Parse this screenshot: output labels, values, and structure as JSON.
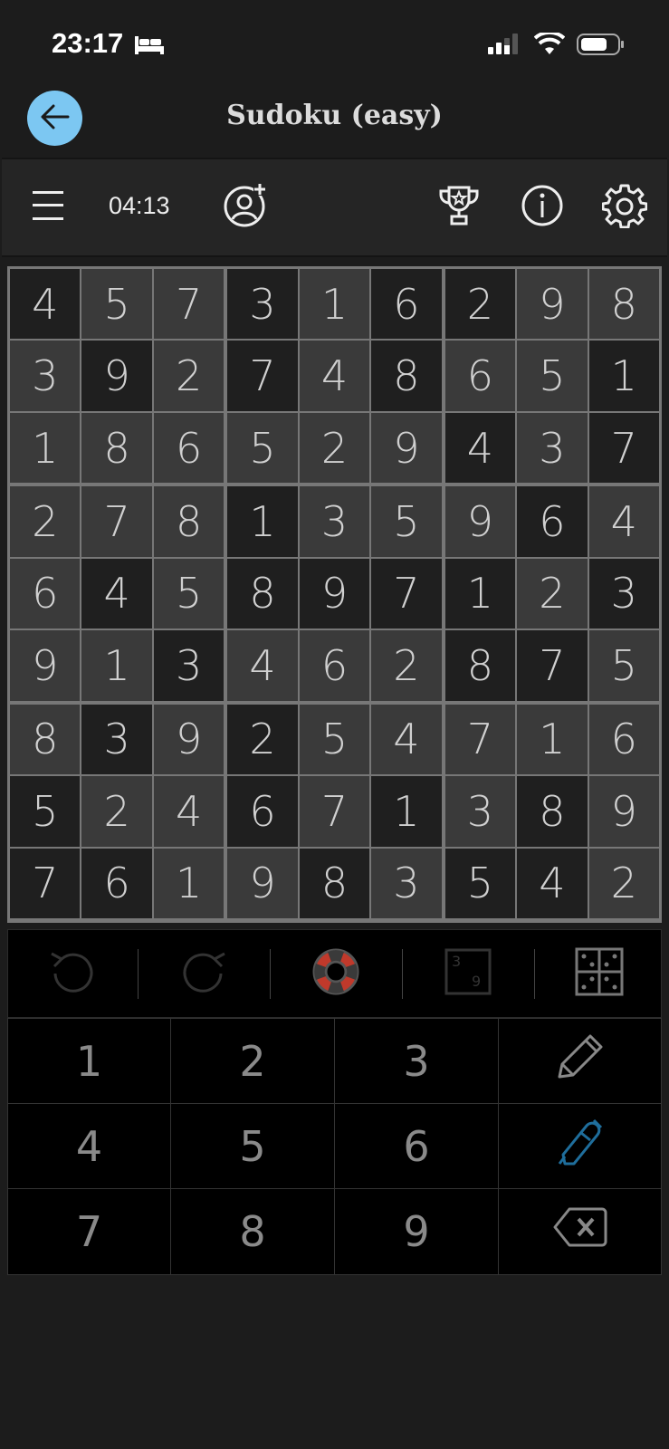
{
  "status_bar": {
    "time": "23:17",
    "icons": [
      "bed-icon",
      "cellular-signal-icon",
      "wifi-icon",
      "battery-icon"
    ]
  },
  "header": {
    "title": "Sudoku (easy)",
    "back_icon": "arrow-left-icon",
    "back_color": "#7cc7f2"
  },
  "toolbar": {
    "timer": "04:13",
    "icons": [
      "menu-icon",
      "add-user-icon",
      "trophy-icon",
      "info-icon",
      "settings-icon"
    ]
  },
  "grid": {
    "rows": [
      [
        "4",
        "5",
        "7",
        "3",
        "1",
        "6",
        "2",
        "9",
        "8"
      ],
      [
        "3",
        "9",
        "2",
        "7",
        "4",
        "8",
        "6",
        "5",
        "1"
      ],
      [
        "1",
        "8",
        "6",
        "5",
        "2",
        "9",
        "4",
        "3",
        "7"
      ],
      [
        "2",
        "7",
        "8",
        "1",
        "3",
        "5",
        "9",
        "6",
        "4"
      ],
      [
        "6",
        "4",
        "5",
        "8",
        "9",
        "7",
        "1",
        "2",
        "3"
      ],
      [
        "9",
        "1",
        "3",
        "4",
        "6",
        "2",
        "8",
        "7",
        "5"
      ],
      [
        "8",
        "3",
        "9",
        "2",
        "5",
        "4",
        "7",
        "1",
        "6"
      ],
      [
        "5",
        "2",
        "4",
        "6",
        "7",
        "1",
        "3",
        "8",
        "9"
      ],
      [
        "7",
        "6",
        "1",
        "9",
        "8",
        "3",
        "5",
        "4",
        "2"
      ]
    ],
    "shading": [
      "DLLDLDDLL",
      "LDLDLDLLD",
      "LLLLLLDLD",
      "LLLDLLLDL",
      "LDLDDDDLD",
      "LLDLLLDDL",
      "LDLDLLLLL",
      "DLLDLDLDL",
      "DDLLDLDDL"
    ]
  },
  "controls": {
    "items": [
      "undo-icon",
      "redo-icon",
      "hint-lifebuoy-icon",
      "notes-candidates-icon",
      "grid-layout-icon"
    ],
    "hint_accent": "#c0392b"
  },
  "keypad": {
    "keys": [
      "1",
      "2",
      "3",
      "4",
      "5",
      "6",
      "7",
      "8",
      "9"
    ],
    "tool_icons": [
      "pencil-icon",
      "pen-icon",
      "erase-icon"
    ],
    "pen_active_color": "#1f6e9c"
  }
}
